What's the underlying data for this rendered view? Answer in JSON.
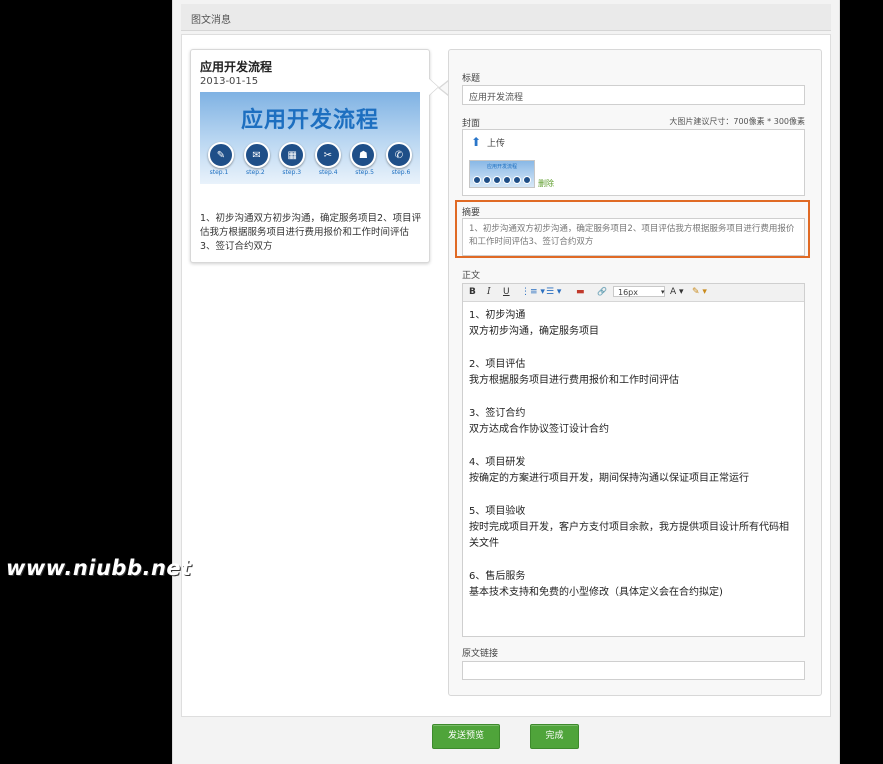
{
  "page": {
    "header_title": "图文消息"
  },
  "preview": {
    "title": "应用开发流程",
    "date": "2013-01-15",
    "cover_title": "应用开发流程",
    "cover_steps": [
      "step.1",
      "step.2",
      "step.3",
      "step.4",
      "step.5",
      "step.6"
    ],
    "summary": "1、初步沟通双方初步沟通，确定服务项目2、项目评估我方根据服务项目进行费用报价和工作时间评估3、签订合约双方"
  },
  "editor": {
    "title_label": "标题",
    "title_value": "应用开发流程",
    "cover_label": "封面",
    "cover_hint": "大图片建议尺寸：700像素 * 300像素",
    "upload_label": "上传",
    "thumb_title": "应用开发流程",
    "delete_label": "删除",
    "summary_label": "摘要",
    "summary_value": "1、初步沟通双方初步沟通，确定服务项目2、项目评估我方根据服务项目进行费用报价和工作时间评估3、签订合约双方",
    "body_label": "正文",
    "toolbar": {
      "bold": "B",
      "italic": "I",
      "underline": "U",
      "ordered_list": "⋮≡ ▾",
      "unordered_list": "☰ ▾",
      "image": "▬",
      "link": "🔗",
      "font_size": "16px",
      "font_size_arrow": "▾",
      "font_color": "A ▾",
      "highlight": "✎ ▾"
    },
    "body_sections": [
      {
        "heading": "1、初步沟通",
        "text": "双方初步沟通，确定服务项目"
      },
      {
        "heading": "2、项目评估",
        "text": "我方根据服务项目进行费用报价和工作时间评估"
      },
      {
        "heading": "3、签订合约",
        "text": "双方达成合作协议签订设计合约"
      },
      {
        "heading": "4、项目研发",
        "text": "按确定的方案进行项目开发，期间保持沟通以保证项目正常运行"
      },
      {
        "heading": "5、项目验收",
        "text": "按时完成项目开发，客户方支付项目余款，我方提供项目设计所有代码相关文件"
      },
      {
        "heading": "6、售后服务",
        "text": "基本技术支持和免费的小型修改（具体定义会在合约拟定)"
      }
    ],
    "source_label": "原文链接",
    "source_value": ""
  },
  "actions": {
    "send_preview": "发送预览",
    "done": "完成"
  },
  "watermark": "www.niubb.net"
}
